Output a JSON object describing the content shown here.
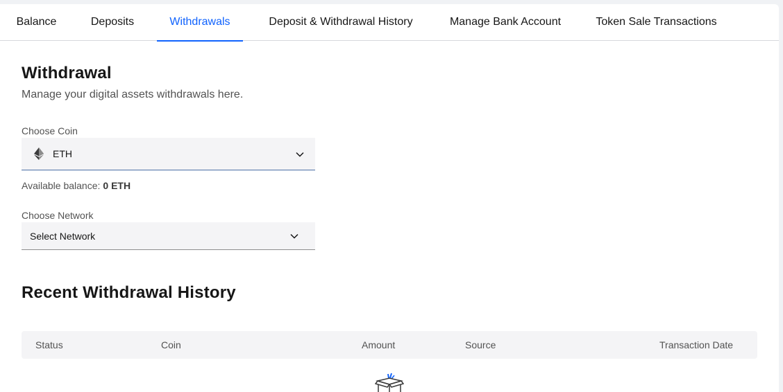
{
  "tabs": [
    {
      "label": "Balance"
    },
    {
      "label": "Deposits"
    },
    {
      "label": "Withdrawals",
      "active": true
    },
    {
      "label": "Deposit & Withdrawal History"
    },
    {
      "label": "Manage Bank Account"
    },
    {
      "label": "Token Sale Transactions"
    }
  ],
  "withdrawal": {
    "title": "Withdrawal",
    "subtitle": "Manage your digital assets withdrawals here.",
    "coin": {
      "label": "Choose Coin",
      "value": "ETH",
      "icon": "ethereum-icon"
    },
    "balance": {
      "label": "Available balance:",
      "amount": "0 ETH"
    },
    "network": {
      "label": "Choose Network",
      "value": "Select Network"
    }
  },
  "history": {
    "title": "Recent Withdrawal History",
    "columns": [
      "Status",
      "Coin",
      "Amount",
      "Source",
      "Transaction Date"
    ],
    "rows": [],
    "empty_icon": "empty-box-icon"
  },
  "colors": {
    "accent": "#0f62fe",
    "text": "#161616",
    "muted": "#525252",
    "field_bg": "#f4f4f6",
    "page_bg": "#f0f2f5"
  }
}
